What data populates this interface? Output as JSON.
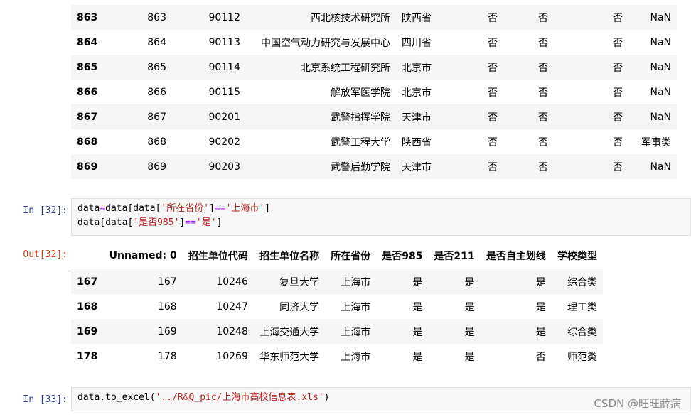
{
  "top_table": {
    "rows": [
      {
        "index": "863",
        "unnamed": "863",
        "code": "90112",
        "name": "西北核技术研究所",
        "province": "陕西省",
        "is985": "否",
        "is211": "否",
        "self": "否",
        "type": "NaN"
      },
      {
        "index": "864",
        "unnamed": "864",
        "code": "90113",
        "name": "中国空气动力研究与发展中心",
        "province": "四川省",
        "is985": "否",
        "is211": "否",
        "self": "否",
        "type": "NaN"
      },
      {
        "index": "865",
        "unnamed": "865",
        "code": "90114",
        "name": "北京系统工程研究所",
        "province": "北京市",
        "is985": "否",
        "is211": "否",
        "self": "否",
        "type": "NaN"
      },
      {
        "index": "866",
        "unnamed": "866",
        "code": "90115",
        "name": "解放军医学院",
        "province": "北京市",
        "is985": "否",
        "is211": "否",
        "self": "否",
        "type": "NaN"
      },
      {
        "index": "867",
        "unnamed": "867",
        "code": "90201",
        "name": "武警指挥学院",
        "province": "天津市",
        "is985": "否",
        "is211": "否",
        "self": "否",
        "type": "NaN"
      },
      {
        "index": "868",
        "unnamed": "868",
        "code": "90202",
        "name": "武警工程大学",
        "province": "陕西省",
        "is985": "否",
        "is211": "否",
        "self": "否",
        "type": "军事类"
      },
      {
        "index": "869",
        "unnamed": "869",
        "code": "90203",
        "name": "武警后勤学院",
        "province": "天津市",
        "is985": "否",
        "is211": "否",
        "self": "否",
        "type": "NaN"
      }
    ]
  },
  "cell32": {
    "in_prompt": "In [32]:",
    "out_prompt": "Out[32]:",
    "line1": {
      "a": "data",
      "op1": "=",
      "b": "data[data[",
      "s1": "'所在省份'",
      "c": "]",
      "op2": "==",
      "s2": "'上海市'",
      "d": "]"
    },
    "line2": {
      "a": "data[data[",
      "s1": "'是否985'",
      "b": "]",
      "op": "==",
      "s2": "'是'",
      "c": "]"
    },
    "output": {
      "headers": [
        "",
        "Unnamed: 0",
        "招生单位代码",
        "招生单位名称",
        "所在省份",
        "是否985",
        "是否211",
        "是否自主划线",
        "学校类型"
      ],
      "rows": [
        {
          "index": "167",
          "unnamed": "167",
          "code": "10246",
          "name": "复旦大学",
          "province": "上海市",
          "is985": "是",
          "is211": "是",
          "self": "是",
          "type": "综合类"
        },
        {
          "index": "168",
          "unnamed": "168",
          "code": "10247",
          "name": "同济大学",
          "province": "上海市",
          "is985": "是",
          "is211": "是",
          "self": "是",
          "type": "理工类"
        },
        {
          "index": "169",
          "unnamed": "169",
          "code": "10248",
          "name": "上海交通大学",
          "province": "上海市",
          "is985": "是",
          "is211": "是",
          "self": "是",
          "type": "综合类"
        },
        {
          "index": "178",
          "unnamed": "178",
          "code": "10269",
          "name": "华东师范大学",
          "province": "上海市",
          "is985": "是",
          "is211": "是",
          "self": "否",
          "type": "师范类"
        }
      ]
    }
  },
  "cell33": {
    "in_prompt": "In [33]:",
    "code": {
      "a": "data",
      "dot": ".",
      "b": "to_excel(",
      "s": "'../R&Q_pic/上海市高校信息表.xls'",
      "c": ")"
    }
  },
  "watermark": "CSDN @旺旺薛病"
}
